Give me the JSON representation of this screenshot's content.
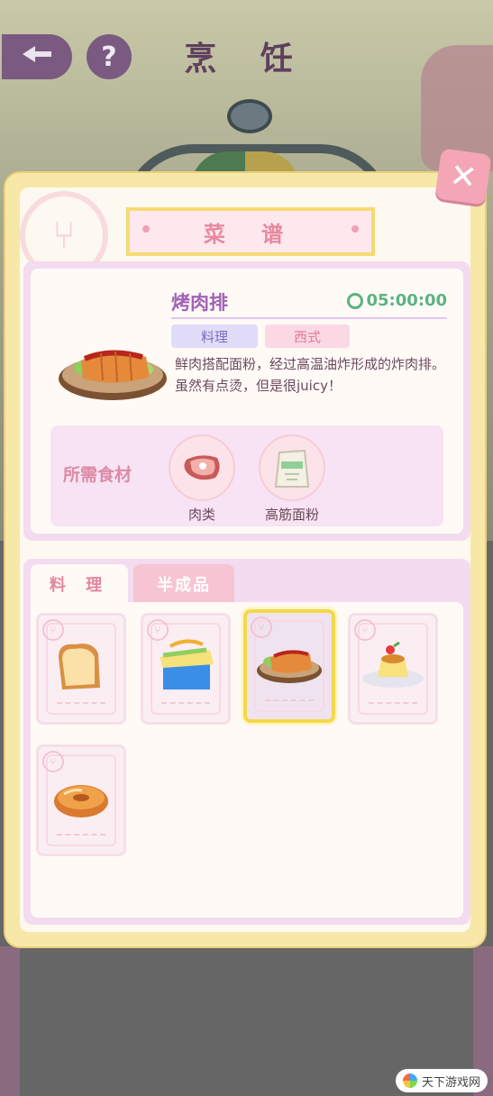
{
  "header": {
    "title": "烹 饪",
    "back_icon": "back-arrow-icon",
    "help_label": "?"
  },
  "panel": {
    "banner_title": "菜 谱",
    "close_label": "✕"
  },
  "recipe": {
    "name": "烤肉排",
    "time": "05:00:00",
    "tags": [
      "料理",
      "西式"
    ],
    "description": "鲜肉搭配面粉，经过高温油炸形成的炸肉排。虽然有点烫，但是很juicy！",
    "ingredients_label": "所需食材",
    "ingredients": [
      {
        "name": "肉类",
        "icon": "meat-icon"
      },
      {
        "name": "高筋面粉",
        "icon": "flour-bag-icon"
      }
    ]
  },
  "tabs": [
    {
      "label": "料 理",
      "active": true
    },
    {
      "label": "半成品",
      "active": false
    }
  ],
  "dishes": [
    {
      "icon": "bread-loaf-icon",
      "selected": false
    },
    {
      "icon": "sandwich-box-icon",
      "selected": false
    },
    {
      "icon": "fried-cutlet-icon",
      "selected": true
    },
    {
      "icon": "pudding-icon",
      "selected": false
    },
    {
      "icon": "donut-icon",
      "selected": false
    }
  ],
  "watermark": {
    "text": "天下游戏网"
  },
  "colors": {
    "panel_frame": "#f7e8a8",
    "accent_pink": "#e888a0",
    "recipe_name": "#a162b6",
    "timer_green": "#5bb383"
  }
}
